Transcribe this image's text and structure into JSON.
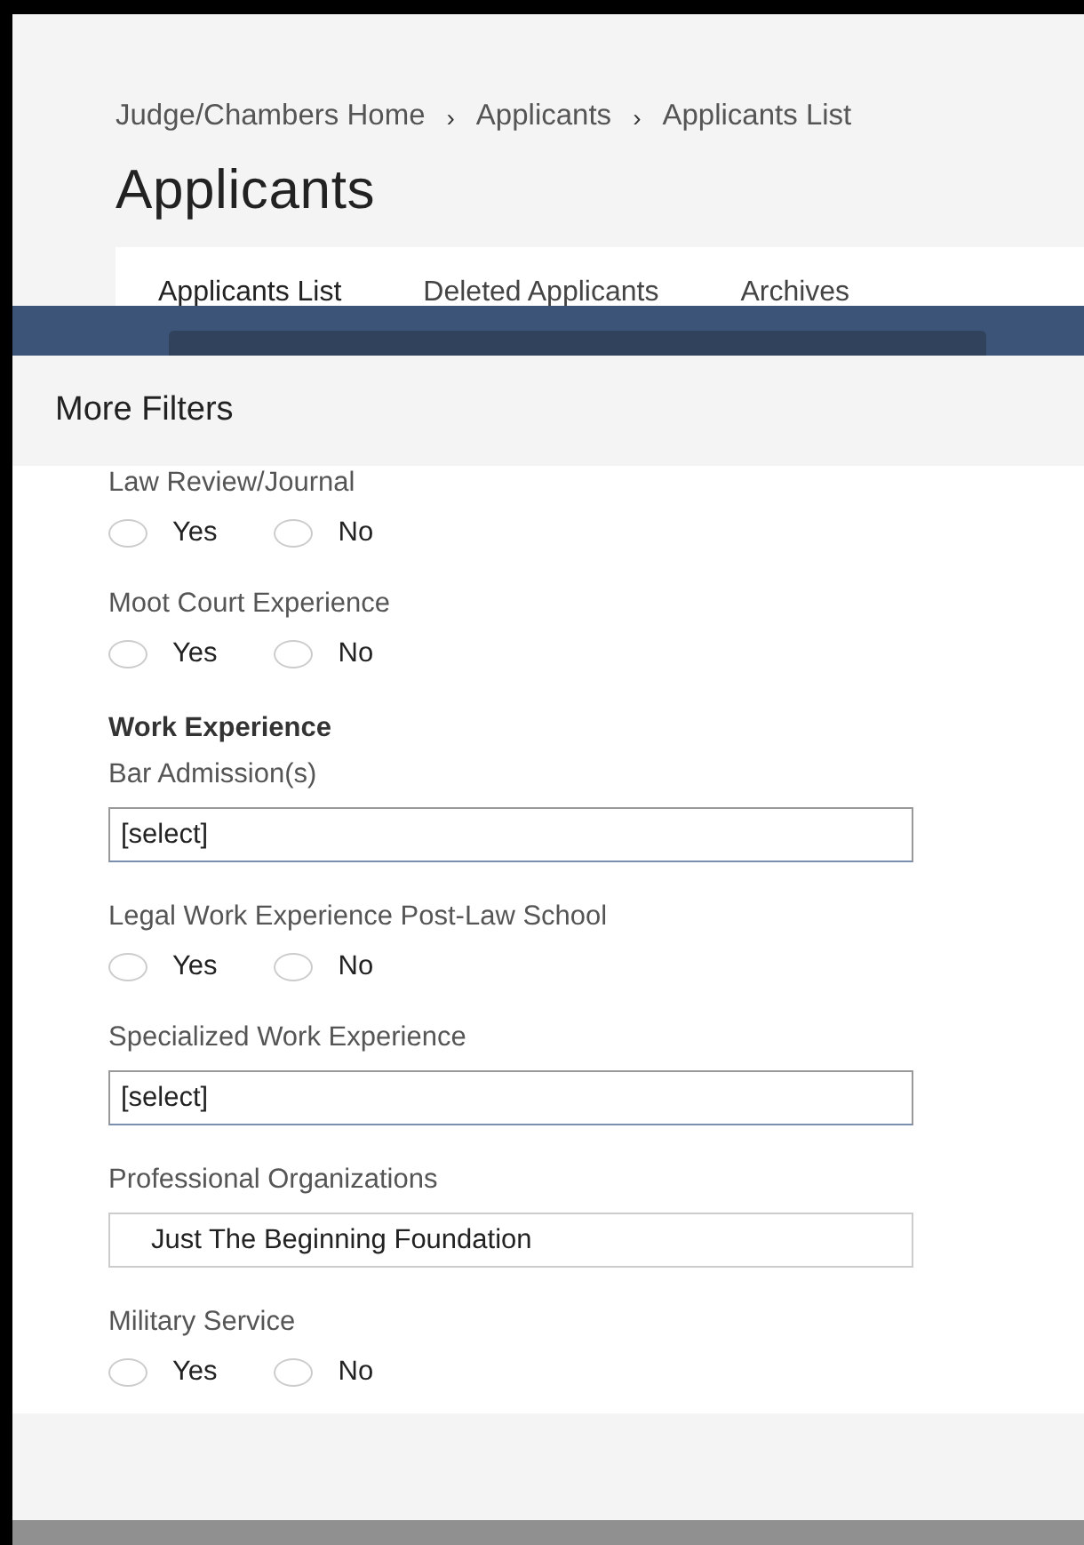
{
  "breadcrumb": [
    {
      "label": "Judge/Chambers Home"
    },
    {
      "label": "Applicants"
    },
    {
      "label": "Applicants List"
    }
  ],
  "separator": "›",
  "page_title": "Applicants",
  "tabs": [
    {
      "label": "Applicants List",
      "selected": true
    },
    {
      "label": "Deleted Applicants",
      "selected": false
    },
    {
      "label": "Archives",
      "selected": false
    }
  ],
  "modal": {
    "title": "More Filters",
    "fields": [
      {
        "kind": "radio",
        "label": "Law Review/Journal",
        "options": [
          {
            "label": "Yes",
            "selected": false
          },
          {
            "label": "No",
            "selected": false
          }
        ]
      },
      {
        "kind": "radio",
        "label": "Moot Court Experience",
        "options": [
          {
            "label": "Yes",
            "selected": false
          },
          {
            "label": "No",
            "selected": false
          }
        ]
      },
      {
        "kind": "heading",
        "label": "Work Experience"
      },
      {
        "kind": "select",
        "label": "Bar Admission(s)",
        "value": "[select]"
      },
      {
        "kind": "radio",
        "label": "Legal Work Experience Post-Law School",
        "options": [
          {
            "label": "Yes",
            "selected": false
          },
          {
            "label": "No",
            "selected": false
          }
        ]
      },
      {
        "kind": "select",
        "label": "Specialized Work Experience",
        "value": "[select]"
      },
      {
        "kind": "text",
        "label": "Professional Organizations",
        "value": "Just The Beginning Foundation"
      },
      {
        "kind": "radio",
        "label": "Military Service",
        "options": [
          {
            "label": "Yes",
            "selected": false
          },
          {
            "label": "No",
            "selected": false
          }
        ]
      }
    ]
  }
}
